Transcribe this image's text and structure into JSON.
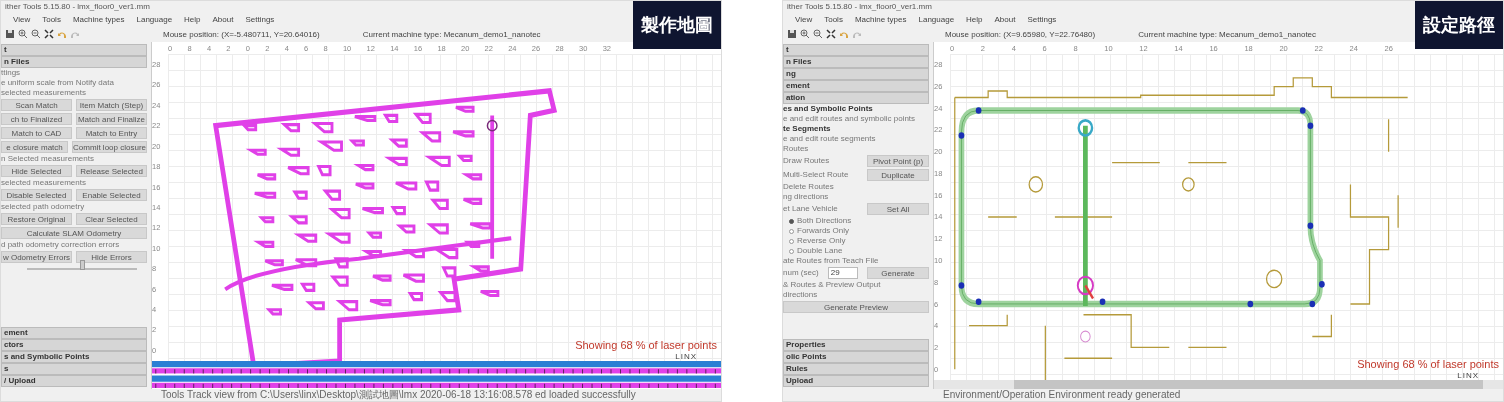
{
  "panels": [
    {
      "window_title": "ither Tools 5.15.80 - lmx_floor0_ver1.mm",
      "menu": [
        "View",
        "Tools",
        "Machine types",
        "Language",
        "Help",
        "About",
        "Settings"
      ],
      "mouse_position": "Mouse position: (X=-5.480711, Y=20.64016)",
      "machine_type": "Current machine type: Mecanum_demo1_nanotec",
      "overlay_label": "製作地圖",
      "kind": "mapping",
      "sidebar": [
        {
          "kind": "header",
          "label": "t"
        },
        {
          "kind": "header",
          "label": "n Files"
        },
        {
          "kind": "text",
          "label": "ttings"
        },
        {
          "kind": "text",
          "label": "e uniform scale from Notify data"
        },
        {
          "kind": "text",
          "label": "selected measurements"
        },
        {
          "kind": "buttons",
          "buttons": [
            "Scan Match",
            "Item Match (Step)"
          ]
        },
        {
          "kind": "buttons",
          "buttons": [
            "ch to Finalized",
            "Match and Finalize"
          ]
        },
        {
          "kind": "buttons",
          "buttons": [
            "Match to CAD",
            "Match to Entry"
          ]
        },
        {
          "kind": "buttons",
          "buttons": [
            "e closure match",
            "Commit loop closure"
          ]
        },
        {
          "kind": "text",
          "label": "n Selected measurements"
        },
        {
          "kind": "buttons",
          "buttons": [
            "Hide Selected",
            "Release Selected"
          ]
        },
        {
          "kind": "text",
          "label": "selected measurements"
        },
        {
          "kind": "buttons",
          "buttons": [
            "Disable Selected",
            "Enable Selected"
          ]
        },
        {
          "kind": "text",
          "label": "selected path odometry"
        },
        {
          "kind": "buttons",
          "buttons": [
            "Restore Original",
            "Clear Selected"
          ]
        },
        {
          "kind": "buttons",
          "buttons": [
            "Calculate SLAM Odometry"
          ]
        },
        {
          "kind": "text",
          "label": "d path odometry correction errors"
        },
        {
          "kind": "buttons",
          "buttons": [
            "w Odometry Errors",
            "Hide Errors"
          ]
        },
        {
          "kind": "slider",
          "level": 0.5
        },
        {
          "kind": "header",
          "label": "ement"
        },
        {
          "kind": "header",
          "label": "ctors"
        },
        {
          "kind": "header",
          "label": "s and Symbolic Points"
        },
        {
          "kind": "header",
          "label": "s"
        },
        {
          "kind": "header",
          "label": "/ Upload"
        }
      ],
      "top_ruler": [
        "0",
        "8",
        "4",
        "2",
        "0",
        "2",
        "4",
        "6",
        "8",
        "10",
        "12",
        "14",
        "16",
        "18",
        "20",
        "22",
        "24",
        "26",
        "28",
        "30",
        "32"
      ],
      "left_ruler": [
        "28",
        "26",
        "24",
        "22",
        "20",
        "18",
        "16",
        "14",
        "12",
        "10",
        "8",
        "6",
        "4",
        "2",
        "0"
      ],
      "laser_status": "Showing  68 % of laser points",
      "logo": "LINX",
      "timeline": true,
      "status": "Tools Track view from C:\\Users\\linx\\Desktop\\測試地圖\\lmx  2020-06-18 13:16:08.578 ed loaded successfully"
    },
    {
      "window_title": "ither Tools 5.15.80 - lmx_floor0_ver1.mm",
      "menu": [
        "View",
        "Tools",
        "Machine types",
        "Language",
        "Help",
        "About",
        "Settings"
      ],
      "mouse_position": "Mouse position: (X=9.65980, Y=22.76480)",
      "machine_type": "Current machine type: Mecanum_demo1_nanotec",
      "overlay_label": "設定路徑",
      "kind": "routing",
      "sidebar": [
        {
          "kind": "header",
          "label": "t"
        },
        {
          "kind": "header",
          "label": "n Files"
        },
        {
          "kind": "header",
          "label": "ng"
        },
        {
          "kind": "header",
          "label": "ement"
        },
        {
          "kind": "header",
          "label": "ation"
        },
        {
          "kind": "heading",
          "label": "es and Symbolic Points"
        },
        {
          "kind": "text",
          "label": "e and edit routes and symbolic points"
        },
        {
          "kind": "heading",
          "label": "te Segments"
        },
        {
          "kind": "text",
          "label": "e and edit route segments"
        },
        {
          "kind": "text",
          "label": "Routes"
        },
        {
          "kind": "row",
          "label": "Draw Routes",
          "button": "Pivot Point (p)"
        },
        {
          "kind": "row",
          "label": "Multi-Select Route",
          "button": "Duplicate"
        },
        {
          "kind": "text",
          "label": "Delete Routes"
        },
        {
          "kind": "text",
          "label": "ng directions"
        },
        {
          "kind": "row",
          "label": "et Lane Vehicle",
          "button": "Set All"
        },
        {
          "kind": "radio",
          "label": "Both Directions",
          "selected": true
        },
        {
          "kind": "radio",
          "label": "Forwards Only",
          "selected": false
        },
        {
          "kind": "radio",
          "label": "Reverse Only",
          "selected": false
        },
        {
          "kind": "radio",
          "label": "Double Lane",
          "selected": false
        },
        {
          "kind": "text",
          "label": "ate Routes from Teach File"
        },
        {
          "kind": "spin",
          "label": "num (sec)",
          "value": "29",
          "button": "Generate"
        },
        {
          "kind": "text",
          "label": "& Routes & Preview Output"
        },
        {
          "kind": "text",
          "label": "directions"
        },
        {
          "kind": "buttons",
          "buttons": [
            "Generate Preview"
          ]
        },
        {
          "kind": "header",
          "label": "Properties"
        },
        {
          "kind": "header",
          "label": "olic Points"
        },
        {
          "kind": "header",
          "label": "Rules"
        },
        {
          "kind": "header",
          "label": "Upload"
        }
      ],
      "top_ruler": [
        "0",
        "2",
        "4",
        "6",
        "8",
        "10",
        "12",
        "14",
        "16",
        "18",
        "20",
        "22",
        "24",
        "26"
      ],
      "left_ruler": [
        "28",
        "26",
        "24",
        "22",
        "20",
        "18",
        "16",
        "14",
        "12",
        "10",
        "8",
        "6",
        "4",
        "2",
        "0"
      ],
      "laser_status": "Showing  68 % of laser points",
      "logo": "LINX",
      "timeline": false,
      "status": "Environment/Operation Environment ready generated"
    }
  ]
}
